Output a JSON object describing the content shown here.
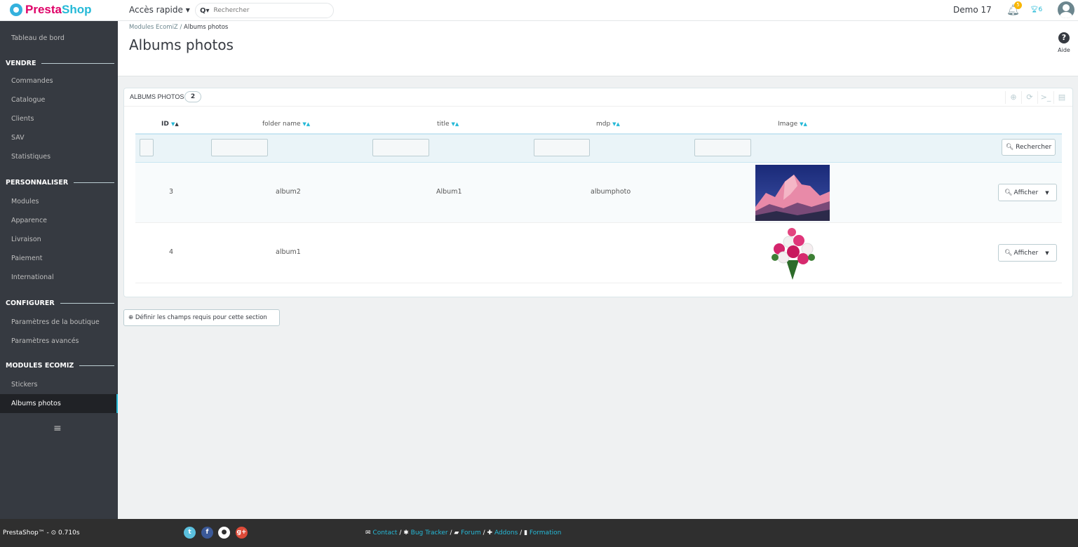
{
  "topbar": {
    "logo_part1": "Presta",
    "logo_part2": "Shop",
    "quick_access": "Accès rapide ▾",
    "search_placeholder": "Rechercher",
    "shop_name": "Demo 17",
    "notifications_count": "5",
    "trophy_count": "6"
  },
  "sidebar": {
    "dashboard": "Tableau de bord",
    "section_sell": "VENDRE",
    "sell_items": [
      "Commandes",
      "Catalogue",
      "Clients",
      "SAV",
      "Statistiques"
    ],
    "section_customize": "PERSONNALISER",
    "customize_items": [
      "Modules",
      "Apparence",
      "Livraison",
      "Paiement",
      "International"
    ],
    "section_configure": "CONFIGURER",
    "configure_items": [
      "Paramètres de la boutique",
      "Paramètres avancés"
    ],
    "section_modules": "MODULES ECOMIZ",
    "modules_items": [
      "Stickers",
      "Albums photos"
    ]
  },
  "header": {
    "breadcrumb_parent": "Modules EcomiZ",
    "breadcrumb_sep": "/",
    "breadcrumb_current": "Albums photos",
    "title": "Albums photos",
    "help_label": "Aide"
  },
  "panel": {
    "title": "ALBUMS PHOTOS",
    "count": "2",
    "columns": [
      "ID",
      "folder name",
      "title",
      "mdp",
      "Image"
    ],
    "search_button": "Rechercher",
    "view_button": "Afficher",
    "rows": [
      {
        "id": "3",
        "folder": "album2",
        "title": "Album1",
        "mdp": "albumphoto",
        "image": "mountain"
      },
      {
        "id": "4",
        "folder": "album1",
        "title": "",
        "mdp": "",
        "image": "flowers"
      }
    ]
  },
  "define_button": "Définir les champs requis pour cette section",
  "footer": {
    "version": "PrestaShop™ - ⊙ 0.710s",
    "links": [
      "Contact",
      "Bug Tracker",
      "Forum",
      "Addons",
      "Formation"
    ],
    "sep": "/"
  },
  "colors": {
    "accent": "#25b9d7",
    "sidebar": "#363a41",
    "brand_pink": "#df0067"
  }
}
